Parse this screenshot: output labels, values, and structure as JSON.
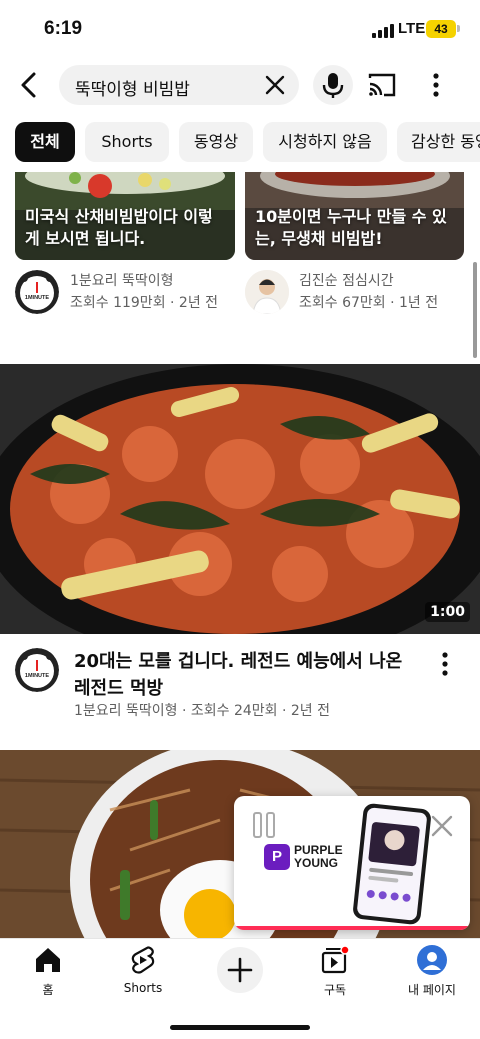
{
  "status": {
    "time": "6:19",
    "network": "LTE",
    "battery": "43"
  },
  "search": {
    "query": "뚝딱이형 비빔밥"
  },
  "chips": [
    {
      "label": "전체"
    },
    {
      "label": "Shorts"
    },
    {
      "label": "동영상"
    },
    {
      "label": "시청하지 않음"
    },
    {
      "label": "감상한 동영"
    }
  ],
  "top_videos": [
    {
      "caption": "미국식 산채비빔밥이다 이렇게 보시면 됩니다.",
      "channel": "1분요리 뚝딱이형",
      "meta": "조회수 119만회 · 2년 전"
    },
    {
      "caption": "10분이면 누구나 만들 수 있는, 무생채 비빔밥!",
      "channel": "김진순 점심시간",
      "meta": "조회수 67만회 · 1년 전"
    }
  ],
  "avatar_badge": "1MINUTE",
  "main_video": {
    "duration": "1:00",
    "title": "20대는 모를 겁니다. 레전드 예능에서 나온 레전드 먹방",
    "meta": "1분요리 뚝딱이형 · 조회수 24만회 · 2년 전"
  },
  "ad": {
    "brand_line1": "PURPLE",
    "brand_line2": "YOUNG",
    "logo_letter": "P"
  },
  "nav": [
    {
      "label": "홈"
    },
    {
      "label": "Shorts"
    },
    {
      "label": ""
    },
    {
      "label": "구독"
    },
    {
      "label": "내 페이지"
    }
  ],
  "colors": {
    "accent_red": "#ff0000",
    "ad_purple": "#6b1dbf",
    "ad_progress": "#ff2d55"
  }
}
